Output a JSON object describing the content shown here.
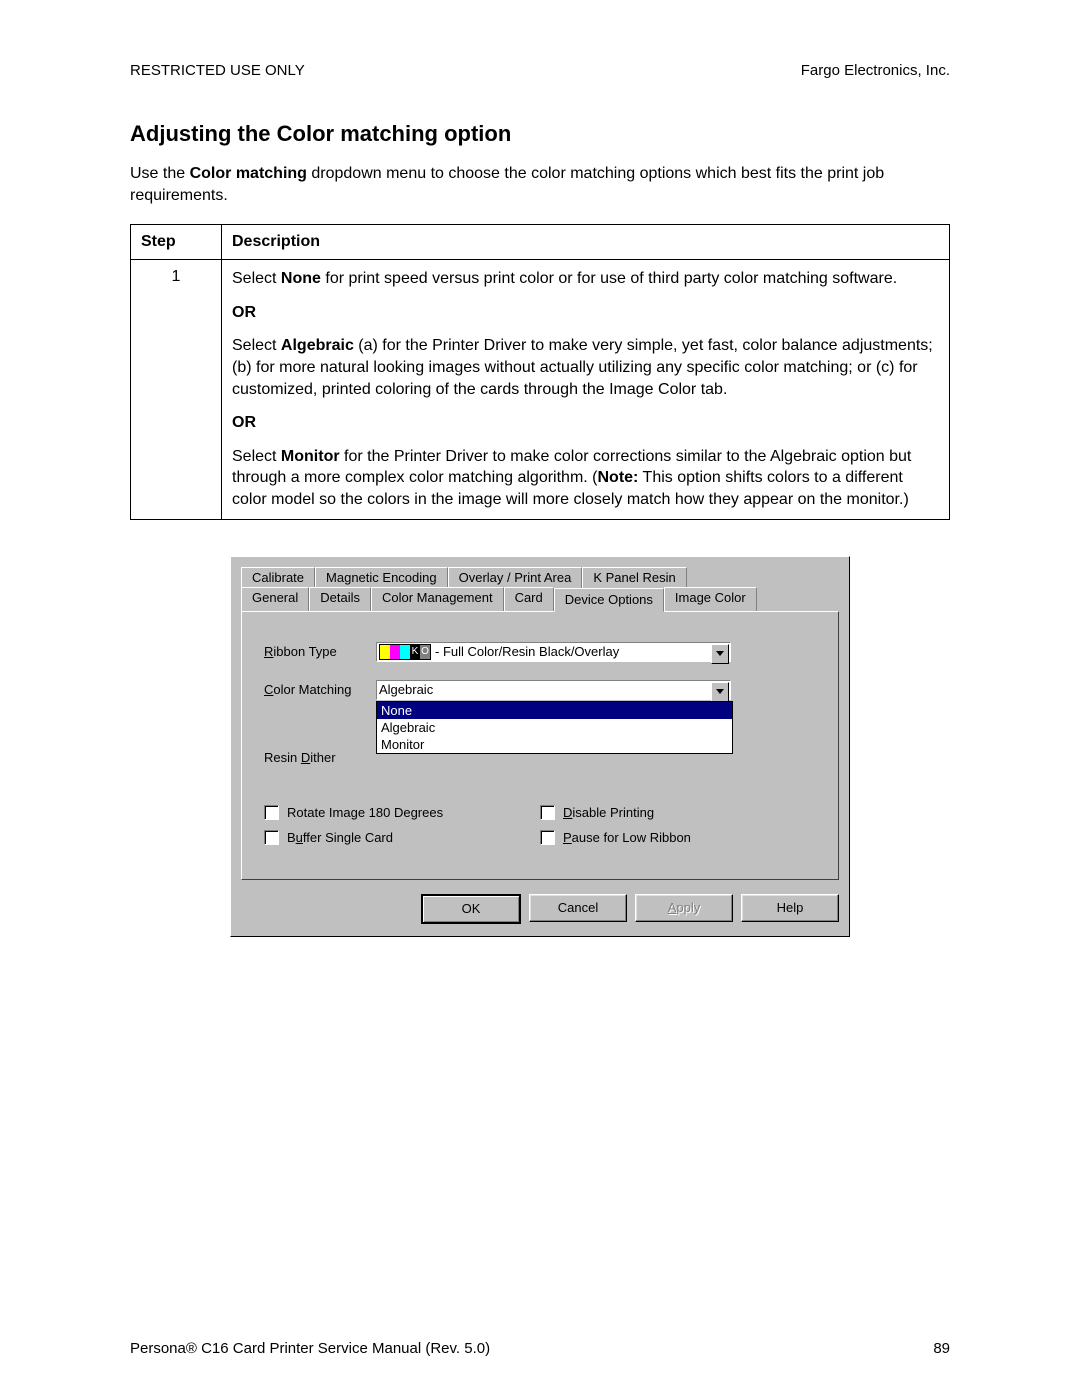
{
  "header": {
    "left": "RESTRICTED USE ONLY",
    "right": "Fargo Electronics, Inc."
  },
  "section_title": "Adjusting the Color matching option",
  "intro": {
    "pre": "Use the ",
    "bold": "Color matching",
    "post": " dropdown menu to choose the color matching options which best fits the print job requirements."
  },
  "table": {
    "headers": {
      "step": "Step",
      "desc": "Description"
    },
    "row1": {
      "step": "1",
      "p1_pre": "Select ",
      "p1_bold": "None",
      "p1_post": " for print speed versus print color or for use of third party color matching software.",
      "or1": "OR",
      "p2_pre": "Select ",
      "p2_bold": "Algebraic",
      "p2_post": " (a) for the Printer Driver to make very simple, yet fast, color balance adjustments; (b) for more natural looking images without actually utilizing any specific color matching; or (c) for customized, printed coloring of the cards through the Image Color tab.",
      "or2": "OR",
      "p3_pre": "Select ",
      "p3_bold": "Monitor",
      "p3_post_a": " for the Printer Driver to make color corrections similar to the Algebraic option but through a more complex color matching algorithm. (",
      "p3_note": "Note:",
      "p3_post_b": " This option shifts colors to a different color model so the colors in the image will more closely match how they appear on the monitor.)"
    }
  },
  "dialog": {
    "tabs_top": [
      "Calibrate",
      "Magnetic Encoding",
      "Overlay / Print Area",
      "K Panel Resin"
    ],
    "tabs_bottom": [
      "General",
      "Details",
      "Color Management",
      "Card",
      "Device Options",
      "Image Color"
    ],
    "active_tab": "Device Options",
    "labels": {
      "ribbon_type": "Ribbon Type",
      "color_matching": "Color Matching",
      "resin_dither": "Resin Dither"
    },
    "ribbon_type_value_text": " - Full Color/Resin Black/Overlay",
    "ribbon_chip_label": "YMCKO",
    "color_matching_value": "Algebraic",
    "color_matching_options": [
      "None",
      "Algebraic",
      "Monitor"
    ],
    "color_matching_highlight_index": 0,
    "resin_dither_value": "",
    "checkboxes": {
      "rotate": "Rotate Image 180 Degrees",
      "buffer": "Buffer Single Card",
      "disable": "Disable Printing",
      "pause": "Pause for Low Ribbon"
    },
    "buttons": {
      "ok": "OK",
      "cancel": "Cancel",
      "apply": "Apply",
      "help": "Help"
    }
  },
  "footer": {
    "left": "Persona® C16 Card Printer Service Manual (Rev. 5.0)",
    "right": "89"
  }
}
